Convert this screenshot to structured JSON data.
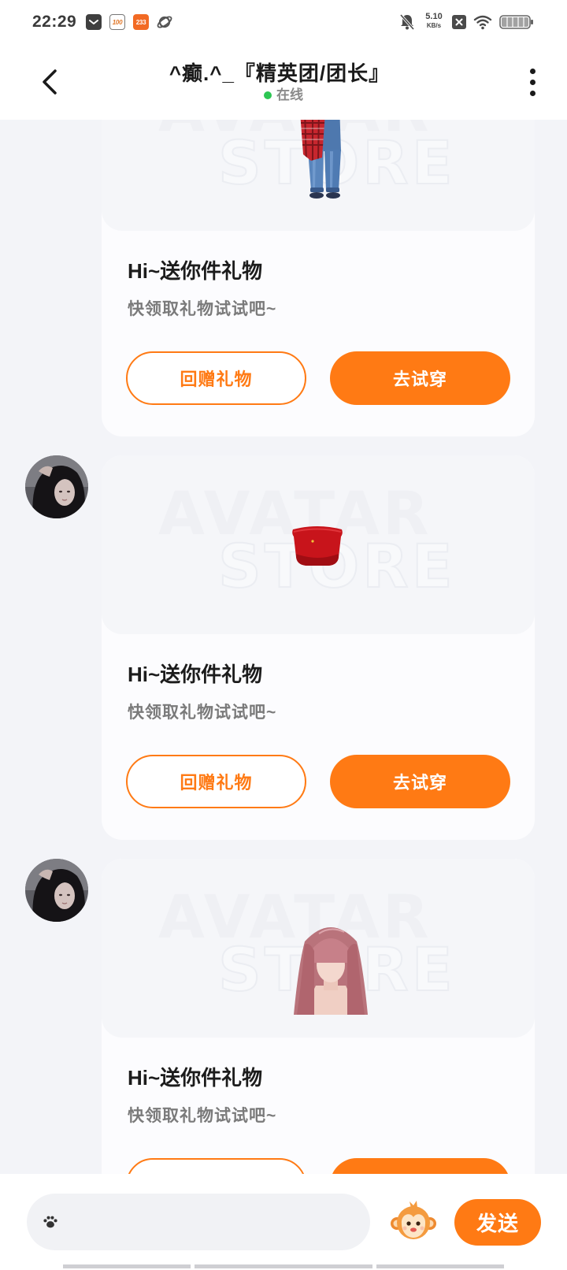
{
  "status_bar": {
    "time": "22:29",
    "app_icons": [
      {
        "icon": "message-icon"
      },
      {
        "icon": "app-100-icon",
        "text": "100"
      },
      {
        "icon": "app-233-icon",
        "text": "233"
      },
      {
        "icon": "planet-icon"
      }
    ],
    "network_speed": {
      "value": "5.10",
      "unit": "KB/s"
    },
    "indicators": [
      "mute-bell-icon",
      "close-box-icon",
      "wifi-icon",
      "battery-icon"
    ],
    "battery_level": 1.0
  },
  "header": {
    "back_icon": "chevron-left-icon",
    "title": "^癫.^_『精英团/团长』",
    "status": "在线",
    "menu_icon": "more-vertical-icon"
  },
  "watermark": {
    "line1": "AVATAR",
    "line2": "STORE"
  },
  "messages": [
    {
      "item_icon": "jeans-icon",
      "title": "Hi~送你件礼物",
      "subtitle": "快领取礼物试试吧~",
      "return_gift_label": "回赠礼物",
      "try_on_label": "去试穿"
    },
    {
      "avatar_icon": "avatar-icon",
      "item_icon": "red-top-icon",
      "title": "Hi~送你件礼物",
      "subtitle": "快领取礼物试试吧~",
      "return_gift_label": "回赠礼物",
      "try_on_label": "去试穿"
    },
    {
      "avatar_icon": "avatar-icon",
      "item_icon": "pink-hair-icon",
      "title": "Hi~送你件礼物",
      "subtitle": "快领取礼物试试吧~"
    }
  ],
  "composer": {
    "input_value": "",
    "left_icon": "paw-icon",
    "sticker_icon": "monkey-mascot-icon",
    "send_label": "发送"
  },
  "colors": {
    "accent": "#ff7a14",
    "online": "#2dc653",
    "page_background": "#f3f4f8"
  }
}
